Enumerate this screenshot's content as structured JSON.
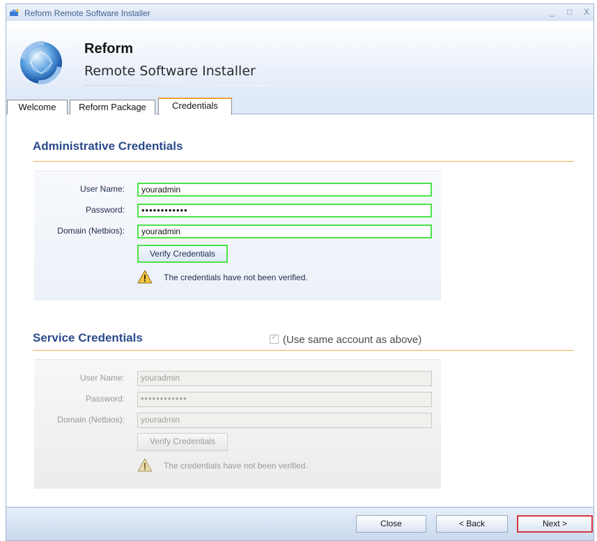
{
  "window": {
    "title": "Reform Remote Software Installer",
    "controls": [
      "_",
      "□",
      "X"
    ]
  },
  "header": {
    "title": "Reform",
    "subtitle": "Remote Software Installer",
    "logo_icon": "globe-logo-icon"
  },
  "tabs": [
    {
      "label": "Welcome",
      "active": false
    },
    {
      "label": "Reform Package",
      "active": false
    },
    {
      "label": "Credentials",
      "active": true
    }
  ],
  "admin": {
    "title": "Administrative Credentials",
    "username_label": "User Name:",
    "username_value": "youradmin",
    "password_label": "Password:",
    "password_value": "••••••••••••",
    "domain_label": "Domain (Netbios):",
    "domain_value": "youradmin",
    "verify_button": "Verify Credentials",
    "status": "The credentials have not been verified."
  },
  "service": {
    "title": "Service Credentials",
    "same_account_label": "(Use same account as above)",
    "same_account_checked": true,
    "username_label": "User Name:",
    "username_value": "youradmin",
    "password_label": "Password:",
    "password_value": "••••••••••••",
    "domain_label": "Domain (Netbios):",
    "domain_value": "youradmin",
    "verify_button": "Verify Credentials",
    "status": "The credentials have not been verified."
  },
  "footer": {
    "close": "Close",
    "back": "< Back",
    "next": "Next >"
  },
  "colors": {
    "section_title": "#2b4a8a",
    "accent_rule": "#f0b050",
    "highlight_green": "#48e548",
    "highlight_red": "#d8343d"
  }
}
